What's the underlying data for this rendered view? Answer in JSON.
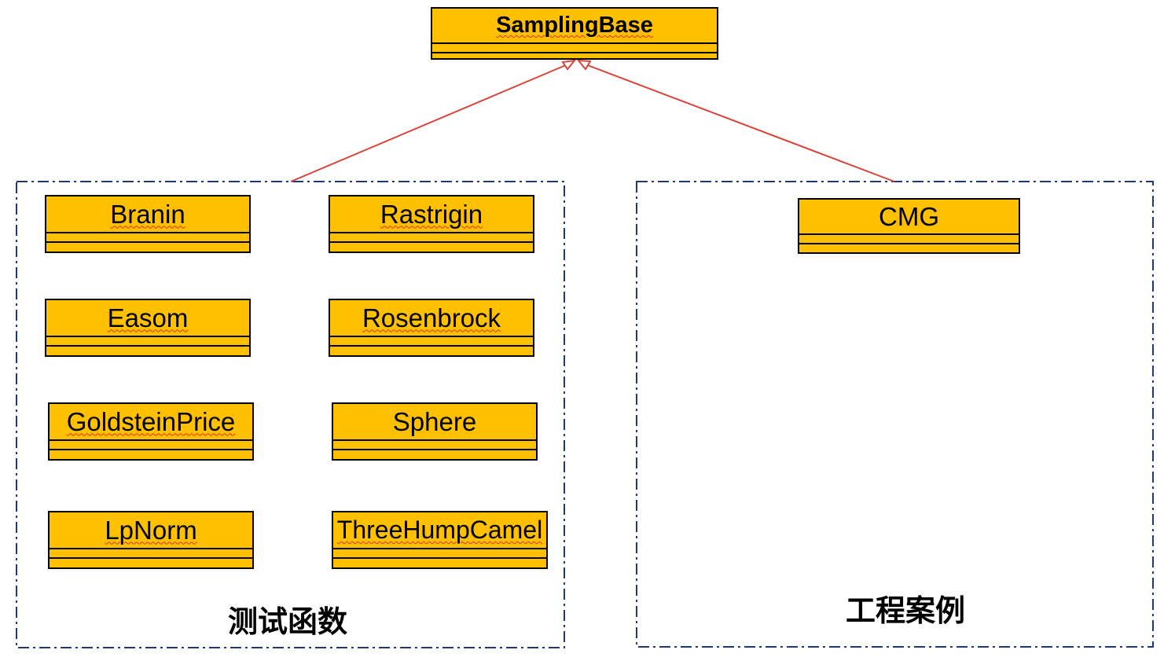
{
  "diagram": {
    "base_class": {
      "name": "SamplingBase"
    },
    "groups": [
      {
        "label": "测试函数",
        "classes": [
          {
            "name": "Branin"
          },
          {
            "name": "Rastrigin"
          },
          {
            "name": "Easom"
          },
          {
            "name": "Rosenbrock"
          },
          {
            "name": "GoldsteinPrice"
          },
          {
            "name": "Sphere"
          },
          {
            "name": "LpNorm"
          },
          {
            "name": "ThreeHumpCamel"
          }
        ]
      },
      {
        "label": "工程案例",
        "classes": [
          {
            "name": "CMG"
          }
        ]
      }
    ],
    "colors": {
      "class_fill": "#ffc000",
      "class_border": "#000000",
      "group_border": "#1f3a6e",
      "inheritance_arrow": "#d9443a",
      "spellcheck_underline": "#e03030"
    }
  }
}
